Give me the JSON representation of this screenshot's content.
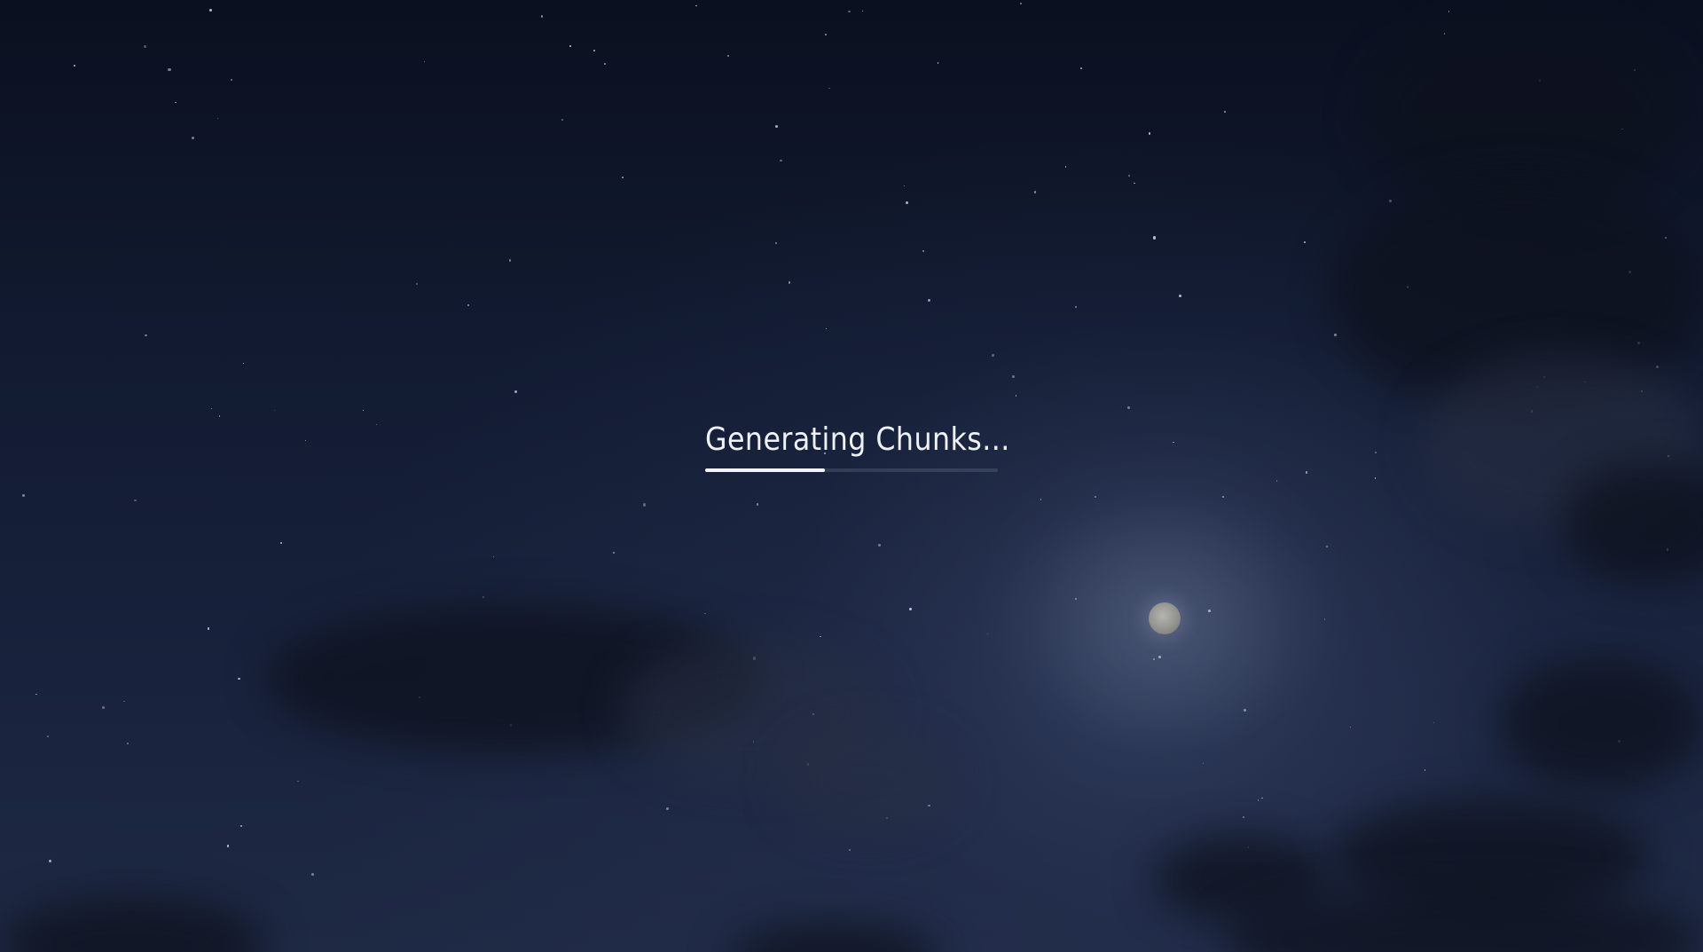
{
  "loading": {
    "status_text": "Generating Chunks...",
    "progress": 0.41
  },
  "scene": {
    "background": "night-sky",
    "moon_icon": "moon-icon",
    "colors": {
      "sky_top": "#0b1020",
      "sky_bottom": "#1e2944",
      "text": "#eef1f6",
      "progress_fill": "#f2f4f8"
    }
  }
}
